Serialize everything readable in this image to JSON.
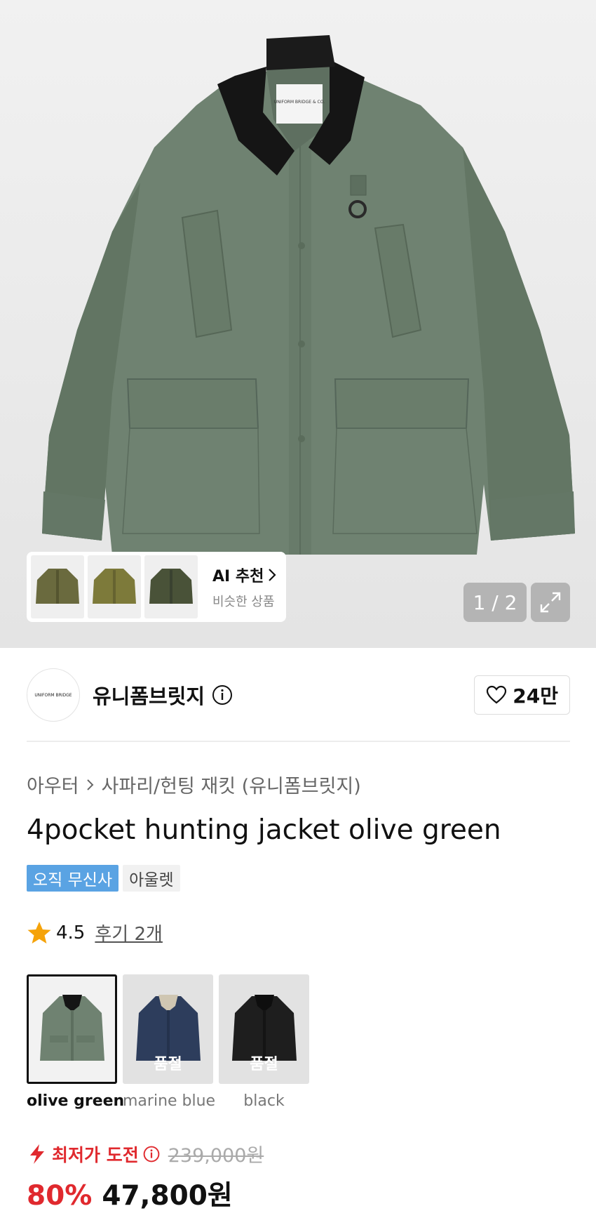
{
  "hero": {
    "ai_card": {
      "title": "AI 추천",
      "subtitle": "비슷한 상품",
      "thumbnails": [
        "olive-jacket-thumb",
        "khaki-jacket-thumb",
        "green-field-jacket-thumb"
      ]
    },
    "counter": "1 / 2",
    "collar_tag": "UNIFORM BRIDGE & CO."
  },
  "brand": {
    "logo_text": "UNIFORM BRIDGE",
    "name": "유니폼브릿지",
    "likes": "24만"
  },
  "product": {
    "breadcrumb": [
      "아우터",
      "사파리/헌팅 재킷 (유니폼브릿지)"
    ],
    "title": "4pocket hunting jacket olive green",
    "badges": [
      "오직 무신사",
      "아울렛"
    ],
    "rating": "4.5",
    "reviews": "후기 2개"
  },
  "colors": [
    {
      "label": "olive green",
      "selected": true,
      "sold_out": ""
    },
    {
      "label": "marine blue",
      "selected": false,
      "sold_out": "품절"
    },
    {
      "label": "black",
      "selected": false,
      "sold_out": "품절"
    }
  ],
  "price": {
    "lowest_label": "최저가 도전",
    "original": "239,000원",
    "discount": "80%",
    "current": "47,800원"
  },
  "palette": {
    "accent_red": "#e0292e",
    "badge_blue": "#5aa3e3",
    "jacket_green": "#6e8270"
  }
}
